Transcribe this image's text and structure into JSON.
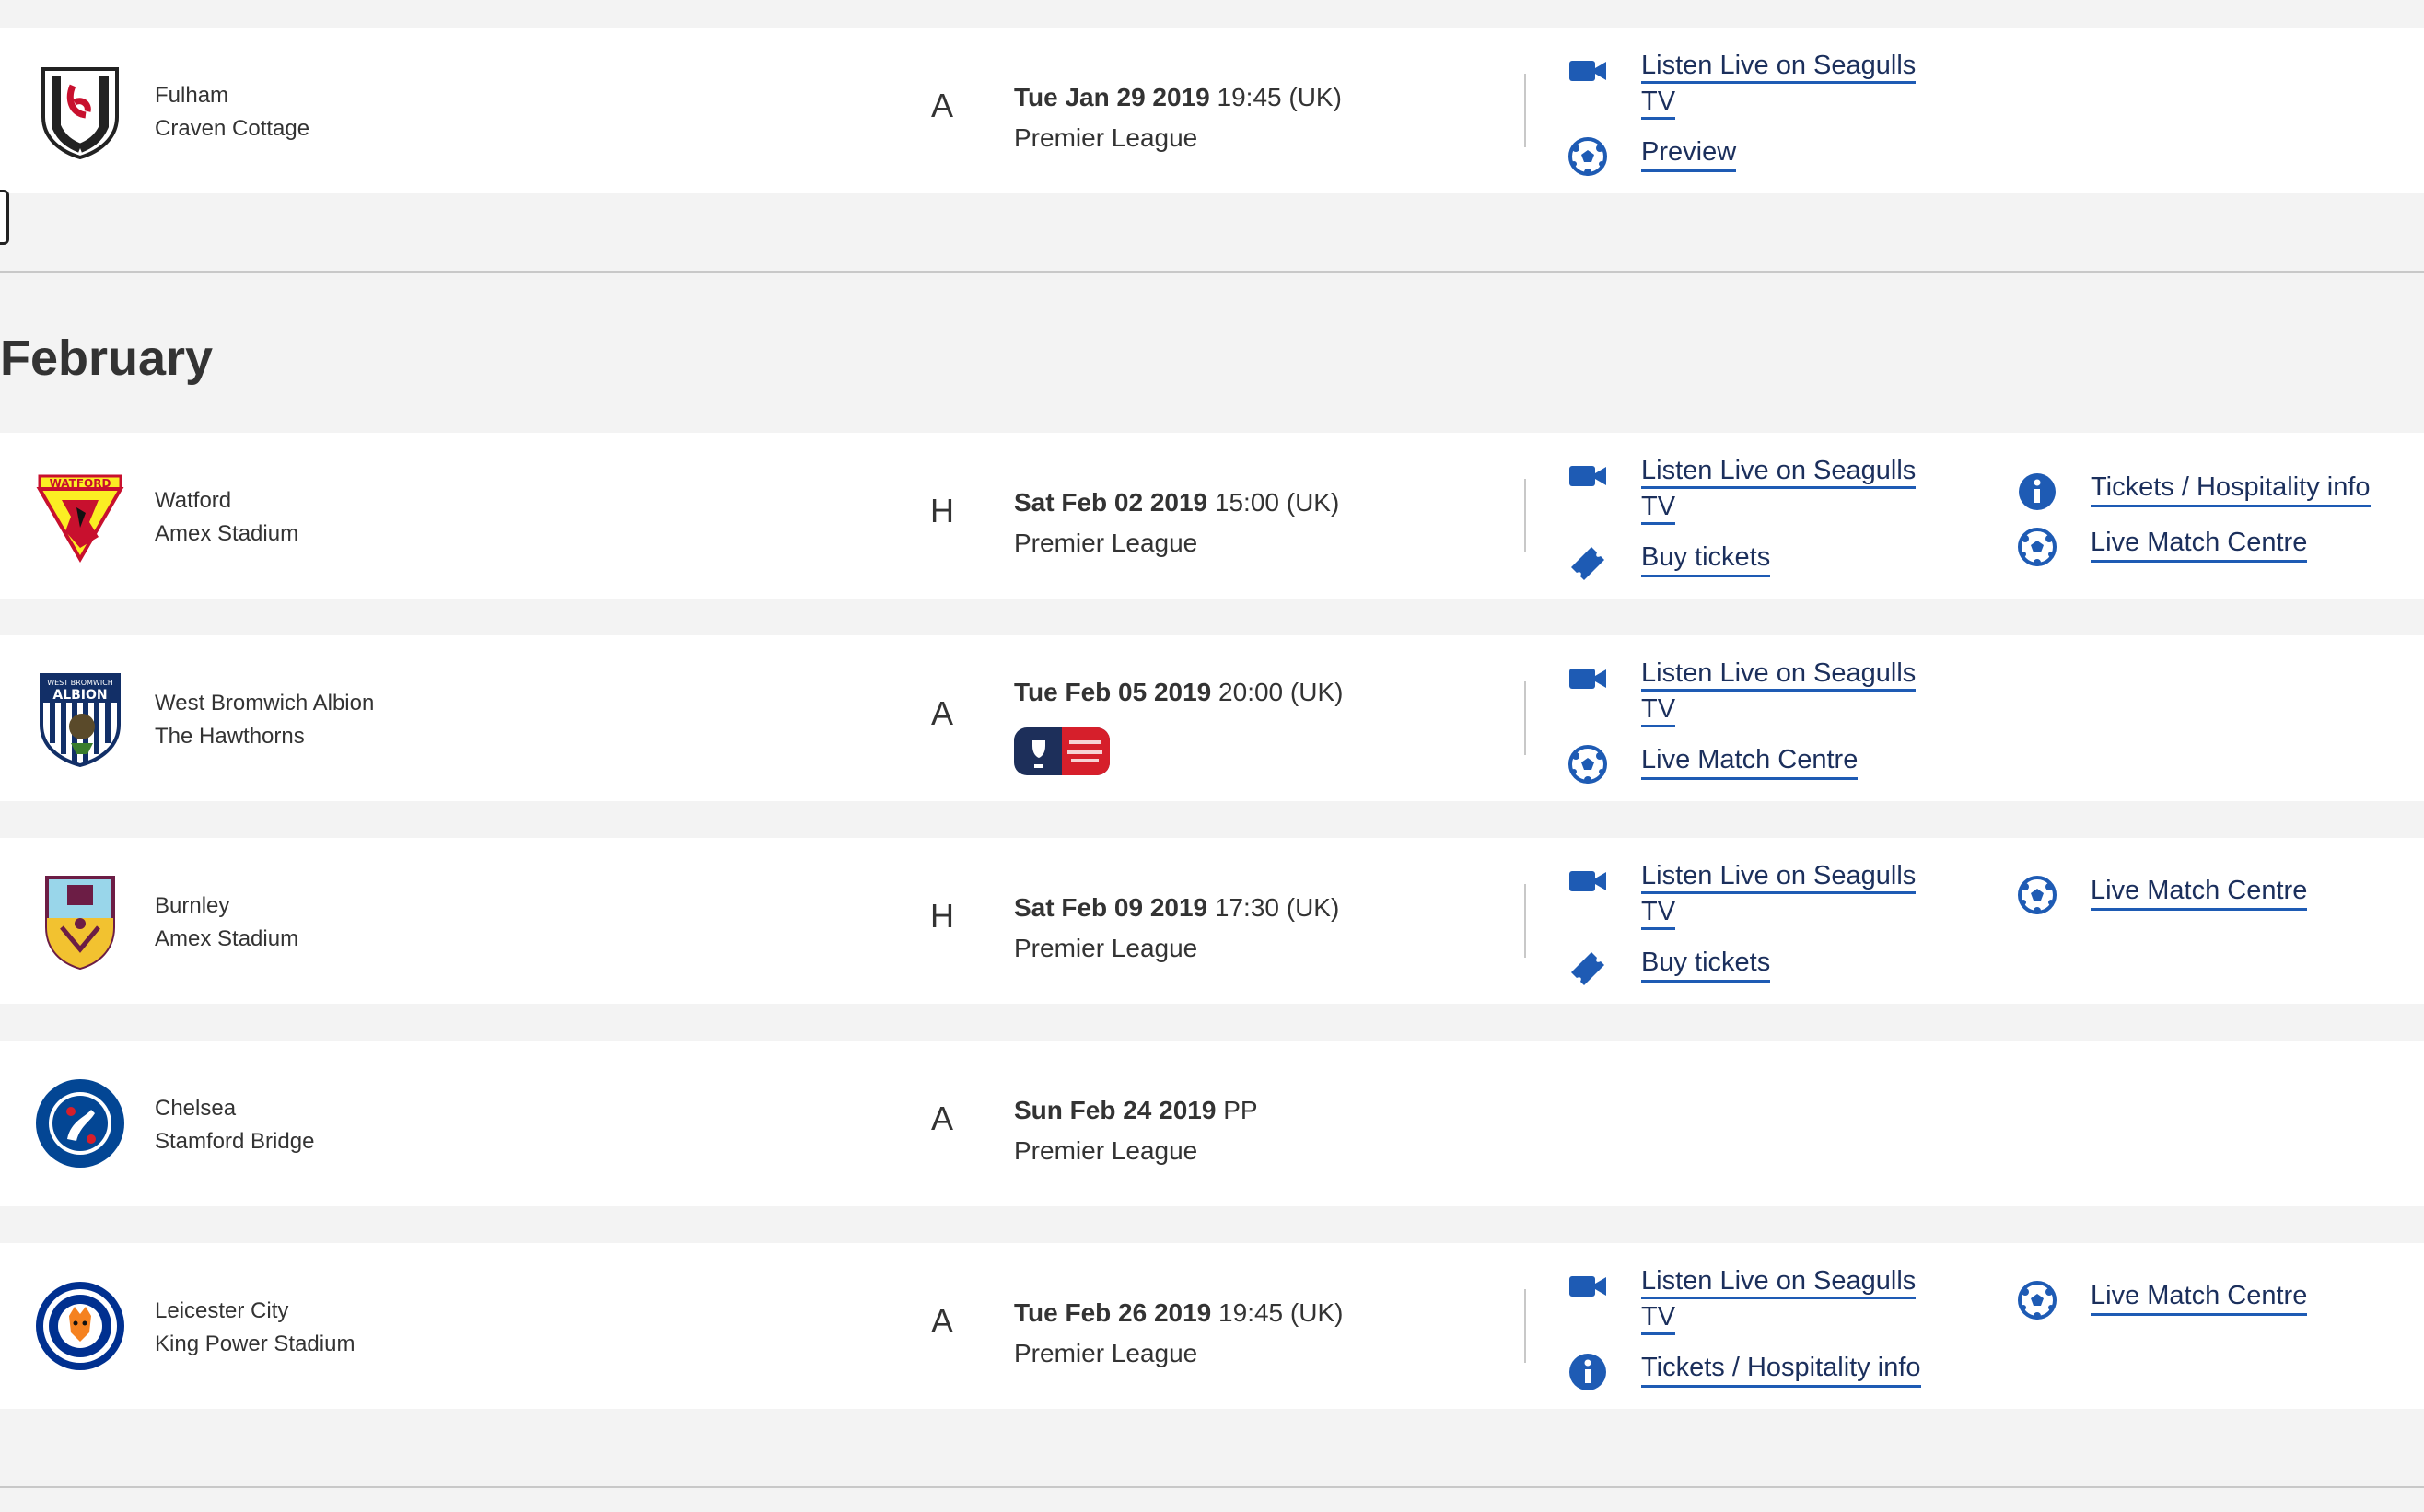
{
  "colors": {
    "link": "#1b2f5c",
    "link_underline": "#1e5bb4",
    "icon": "#1e5bb4",
    "background": "#f3f3f3",
    "card": "#ffffff"
  },
  "months": {
    "february": "February"
  },
  "fixtures": [
    {
      "team": "Fulham",
      "venue": "Craven Cottage",
      "home_away": "A",
      "date": "Tue Jan 29 2019",
      "time": "19:45 (UK)",
      "competition": "Premier League",
      "crest": "fulham-crest-icon",
      "actions": [
        {
          "icon": "video-camera-icon",
          "label_line1": "Listen Live on Seagulls",
          "label_line2": "TV"
        },
        {
          "icon": "football-icon",
          "label": "Preview"
        }
      ]
    },
    {
      "team": "Watford",
      "venue": "Amex Stadium",
      "home_away": "H",
      "date": "Sat Feb 02 2019",
      "time": "15:00 (UK)",
      "competition": "Premier League",
      "crest": "watford-crest-icon",
      "actions": [
        {
          "icon": "video-camera-icon",
          "label_line1": "Listen Live on Seagulls",
          "label_line2": "TV"
        },
        {
          "icon": "ticket-icon",
          "label": "Buy tickets"
        },
        {
          "icon": "info-icon",
          "label": "Tickets / Hospitality info"
        },
        {
          "icon": "football-icon",
          "label": "Live Match Centre"
        }
      ]
    },
    {
      "team": "West Bromwich Albion",
      "venue": "The Hawthorns",
      "home_away": "A",
      "date": "Tue Feb 05 2019",
      "time": "20:00 (UK)",
      "competition": "",
      "crest": "west-brom-crest-icon",
      "competition_logo": "fa-cup-logo",
      "actions": [
        {
          "icon": "video-camera-icon",
          "label_line1": "Listen Live on Seagulls",
          "label_line2": "TV"
        },
        {
          "icon": "football-icon",
          "label": "Live Match Centre"
        }
      ]
    },
    {
      "team": "Burnley",
      "venue": "Amex Stadium",
      "home_away": "H",
      "date": "Sat Feb 09 2019",
      "time": "17:30 (UK)",
      "competition": "Premier League",
      "crest": "burnley-crest-icon",
      "actions": [
        {
          "icon": "video-camera-icon",
          "label_line1": "Listen Live on Seagulls",
          "label_line2": "TV"
        },
        {
          "icon": "ticket-icon",
          "label": "Buy tickets"
        },
        {
          "icon": "football-icon",
          "label": "Live Match Centre"
        }
      ]
    },
    {
      "team": "Chelsea",
      "venue": "Stamford Bridge",
      "home_away": "A",
      "date": "Sun Feb 24 2019",
      "time": "PP",
      "competition": "Premier League",
      "crest": "chelsea-crest-icon",
      "actions": []
    },
    {
      "team": "Leicester City",
      "venue": "King Power Stadium",
      "home_away": "A",
      "date": "Tue Feb 26 2019",
      "time": "19:45 (UK)",
      "competition": "Premier League",
      "crest": "leicester-crest-icon",
      "actions": [
        {
          "icon": "video-camera-icon",
          "label_line1": "Listen Live on Seagulls",
          "label_line2": "TV"
        },
        {
          "icon": "info-icon",
          "label": "Tickets / Hospitality info"
        },
        {
          "icon": "football-icon",
          "label": "Live Match Centre"
        }
      ]
    }
  ]
}
